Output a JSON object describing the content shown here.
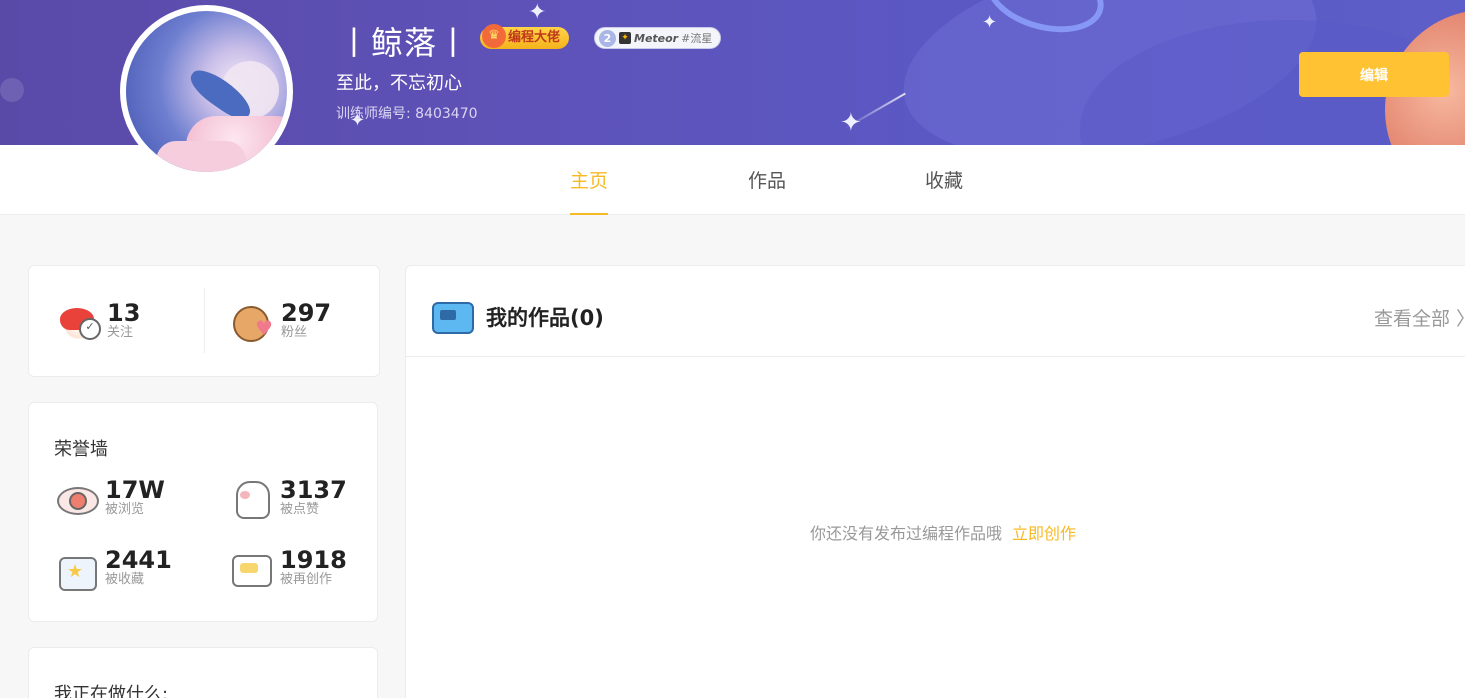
{
  "profile": {
    "name": "丨鲸落丨",
    "badge_main": "编程大佬",
    "badge_level_num": "2",
    "badge_level_title_en": "Meteor",
    "badge_level_title_cn": "#流星",
    "motto": "至此，不忘初心",
    "trainer_id": "训练师编号: 8403470",
    "edit_label": "编辑"
  },
  "tabs": [
    {
      "label": "主页",
      "active": true
    },
    {
      "label": "作品",
      "active": false
    },
    {
      "label": "收藏",
      "active": false
    }
  ],
  "social": {
    "following": {
      "value": "13",
      "label": "关注"
    },
    "fans": {
      "value": "297",
      "label": "粉丝"
    }
  },
  "honor": {
    "title": "荣誉墙",
    "items": [
      {
        "value": "17W",
        "label": "被浏览",
        "icon": "eye-icon"
      },
      {
        "value": "3137",
        "label": "被点赞",
        "icon": "like-icon"
      },
      {
        "value": "2441",
        "label": "被收藏",
        "icon": "favorite-icon"
      },
      {
        "value": "1918",
        "label": "被再创作",
        "icon": "remix-icon"
      }
    ]
  },
  "doing": {
    "title": "我正在做什么:"
  },
  "works": {
    "title": "我的作品(0)",
    "view_all": "查看全部 〉",
    "empty_text": "你还没有发布过编程作品哦",
    "create_link": "立即创作"
  },
  "colors": {
    "accent": "#f7b924",
    "edit_button": "#ffc233",
    "banner": "#5b58c4"
  }
}
